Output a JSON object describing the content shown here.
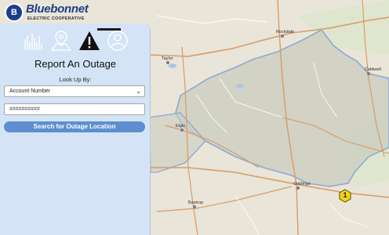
{
  "brand": {
    "badge": "B",
    "name": "Bluebonnet",
    "tagline": "ELECTRIC COOPERATIVE"
  },
  "panel": {
    "tabs": [
      {
        "name": "tab-outage-stats",
        "icon": "bar-chart-icon",
        "active": false
      },
      {
        "name": "tab-outage-map",
        "icon": "map-pin-icon",
        "active": false
      },
      {
        "name": "tab-report-outage",
        "icon": "warning-icon",
        "active": true
      },
      {
        "name": "tab-account",
        "icon": "user-icon",
        "active": false
      }
    ],
    "title": "Report An Outage",
    "lookup_label": "Look Up By:",
    "lookup_select": {
      "selected": "Account Number"
    },
    "account_input": {
      "value": "##########"
    },
    "search_button": "Search for Outage Location"
  },
  "map": {
    "places": [
      "Taylor",
      "Rockdale",
      "Caldwell",
      "Elgin",
      "Giddings",
      "Bastrop"
    ],
    "outage_marker": {
      "label": "1"
    },
    "colors": {
      "land": "#e9e5d8",
      "service_area": "#c9ccbf",
      "boundary": "#8fa8d4",
      "highway": "#d99b63",
      "road": "#ffffff"
    }
  }
}
